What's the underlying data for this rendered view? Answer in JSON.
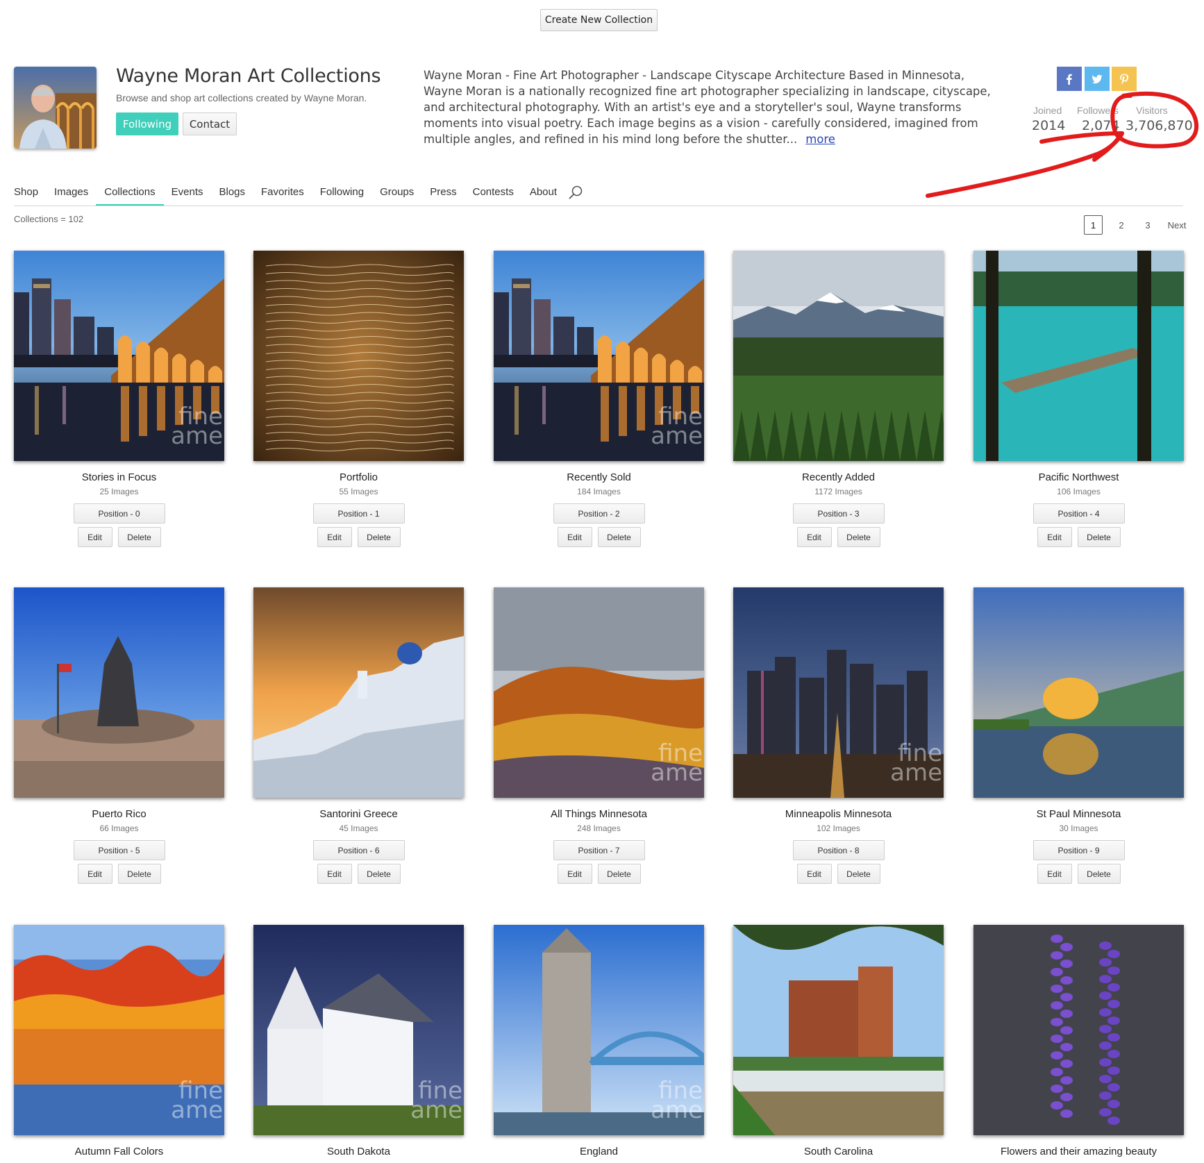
{
  "top": {
    "create_label": "Create New Collection"
  },
  "profile": {
    "title": "Wayne Moran Art Collections",
    "subtitle": "Browse and shop art collections created by Wayne Moran.",
    "following_label": "Following",
    "contact_label": "Contact",
    "bio_lines": [
      "Wayne Moran - Fine Art Photographer - Landscape Cityscape Architecture Based in Minnesota,",
      "Wayne Moran is a nationally recognized fine art photographer specializing in landscape, cityscape,",
      "and architectural photography.   With an artist's eye and a storyteller's soul, Wayne transforms",
      "moments into visual poetry.   Each image begins as a vision - carefully considered, imagined from",
      "multiple angles, and refined in his mind long before the shutter..."
    ],
    "more_label": "more",
    "social": [
      {
        "icon": "facebook-icon",
        "color": "#5a77c3"
      },
      {
        "icon": "twitter-icon",
        "color": "#5cb8ef"
      },
      {
        "icon": "pinterest-icon",
        "color": "#f5c350"
      }
    ],
    "stats": {
      "joined_label": "Joined",
      "joined": "2014",
      "followers_label": "Followers",
      "followers": "2,074",
      "visitors_label": "Visitors",
      "visitors": "3,706,870"
    }
  },
  "annotation": {
    "color": "#e21b1b"
  },
  "nav": {
    "items": [
      "Shop",
      "Images",
      "Collections",
      "Events",
      "Blogs",
      "Favorites",
      "Following",
      "Groups",
      "Press",
      "Contests",
      "About"
    ],
    "active": "Collections",
    "accent": "#3fcfba"
  },
  "collections_count": "Collections = 102",
  "pagination": {
    "pages": [
      "1",
      "2",
      "3"
    ],
    "current": "1",
    "next_label": "Next"
  },
  "buttons": {
    "edit": "Edit",
    "delete": "Delete"
  },
  "collections": [
    {
      "title": "Stories in Focus",
      "count": "25 Images",
      "position": "Position - 0"
    },
    {
      "title": "Portfolio",
      "count": "55 Images",
      "position": "Position - 1"
    },
    {
      "title": "Recently Sold",
      "count": "184 Images",
      "position": "Position - 2"
    },
    {
      "title": "Recently Added",
      "count": "1172 Images",
      "position": "Position - 3"
    },
    {
      "title": "Pacific Northwest",
      "count": "106 Images",
      "position": "Position - 4"
    },
    {
      "title": "Puerto Rico",
      "count": "66 Images",
      "position": "Position - 5"
    },
    {
      "title": "Santorini Greece",
      "count": "45 Images",
      "position": "Position - 6"
    },
    {
      "title": "All Things Minnesota",
      "count": "248 Images",
      "position": "Position - 7"
    },
    {
      "title": "Minneapolis Minnesota",
      "count": "102 Images",
      "position": "Position - 8"
    },
    {
      "title": "St Paul Minnesota",
      "count": "30 Images",
      "position": "Position - 9"
    },
    {
      "title": "Autumn Fall Colors",
      "count": "",
      "position": ""
    },
    {
      "title": "South Dakota",
      "count": "",
      "position": ""
    },
    {
      "title": "England",
      "count": "",
      "position": ""
    },
    {
      "title": "South Carolina",
      "count": "",
      "position": ""
    },
    {
      "title": "Flowers and their amazing beauty",
      "count": "",
      "position": ""
    }
  ],
  "watermark": [
    "fine",
    "ame"
  ]
}
